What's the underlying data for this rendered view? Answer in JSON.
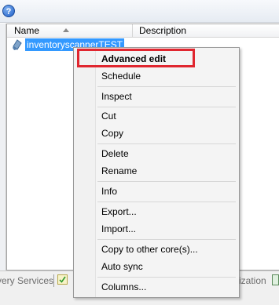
{
  "toolbar": {
    "help_glyph": "?"
  },
  "list": {
    "columns": {
      "name": "Name",
      "description": "Description"
    },
    "rows": [
      {
        "name": "inventoryscannerTEST",
        "icon": "scanner-icon"
      }
    ]
  },
  "statusbar": {
    "left_tab": "very Services",
    "right_tab": "ization"
  },
  "context_menu": {
    "items": [
      {
        "label": "Advanced edit",
        "bold": true
      },
      {
        "label": "Schedule"
      },
      {
        "label": "Inspect"
      },
      {
        "label": "Cut"
      },
      {
        "label": "Copy"
      },
      {
        "label": "Delete"
      },
      {
        "label": "Rename"
      },
      {
        "label": "Info"
      },
      {
        "label": "Export..."
      },
      {
        "label": "Import..."
      },
      {
        "label": "Copy to other core(s)..."
      },
      {
        "label": "Auto sync"
      },
      {
        "label": "Columns..."
      }
    ]
  },
  "colors": {
    "selection": "#3399ff",
    "highlight_box": "#e0262f"
  }
}
